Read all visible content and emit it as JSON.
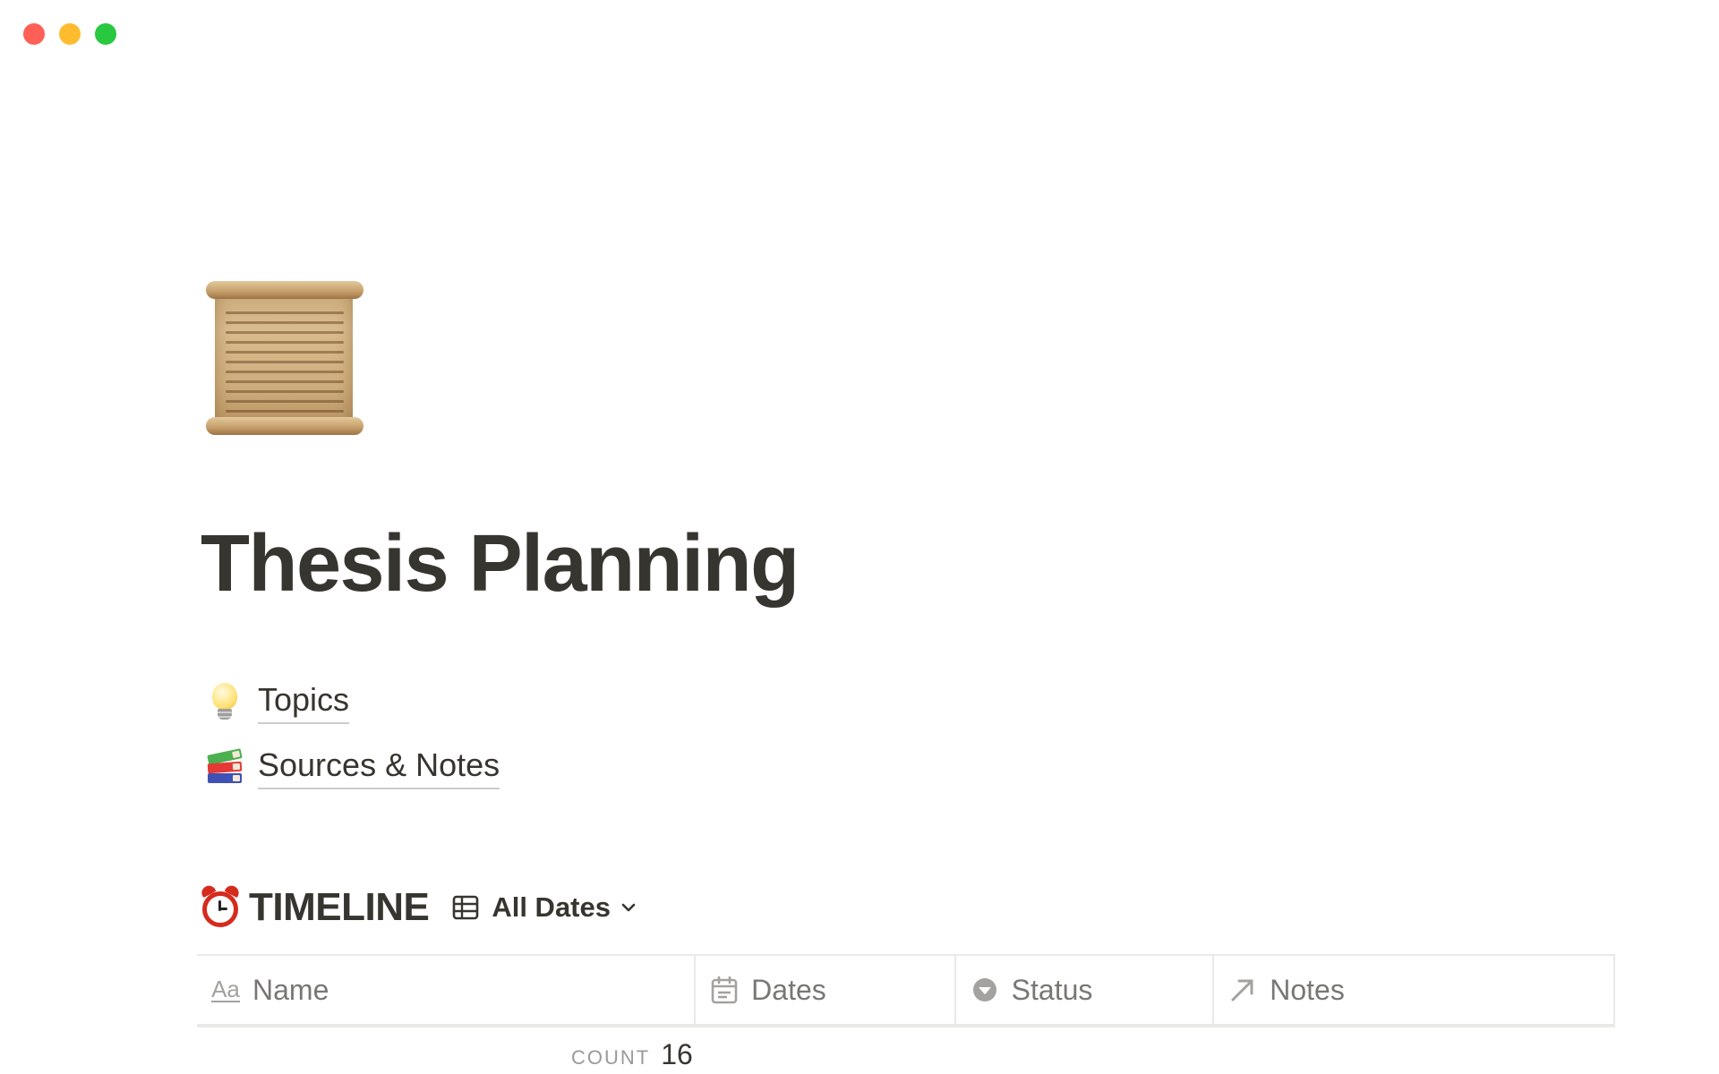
{
  "window": {
    "controls": [
      "close",
      "minimize",
      "zoom"
    ]
  },
  "page": {
    "icon": "scroll-icon",
    "title": "Thesis Planning"
  },
  "links": [
    {
      "icon": "light-bulb-icon",
      "label": "Topics"
    },
    {
      "icon": "books-icon",
      "label": "Sources & Notes"
    }
  ],
  "timeline": {
    "icon": "alarm-clock-icon",
    "title": "TIMELINE",
    "view": {
      "icon": "table-icon",
      "label": "All Dates"
    },
    "columns": [
      {
        "icon": "text-property-icon",
        "icon_text": "Aa",
        "label": "Name"
      },
      {
        "icon": "calendar-icon",
        "label": "Dates"
      },
      {
        "icon": "select-property-icon",
        "label": "Status"
      },
      {
        "icon": "relation-arrow-icon",
        "label": "Notes"
      }
    ],
    "count": {
      "label": "COUNT",
      "value": "16"
    }
  },
  "colors": {
    "text": "#37352f",
    "muted": "#787774",
    "border": "#e9e9e7",
    "close": "#fe5f57",
    "minimize": "#febc2e",
    "zoom": "#28c840"
  }
}
